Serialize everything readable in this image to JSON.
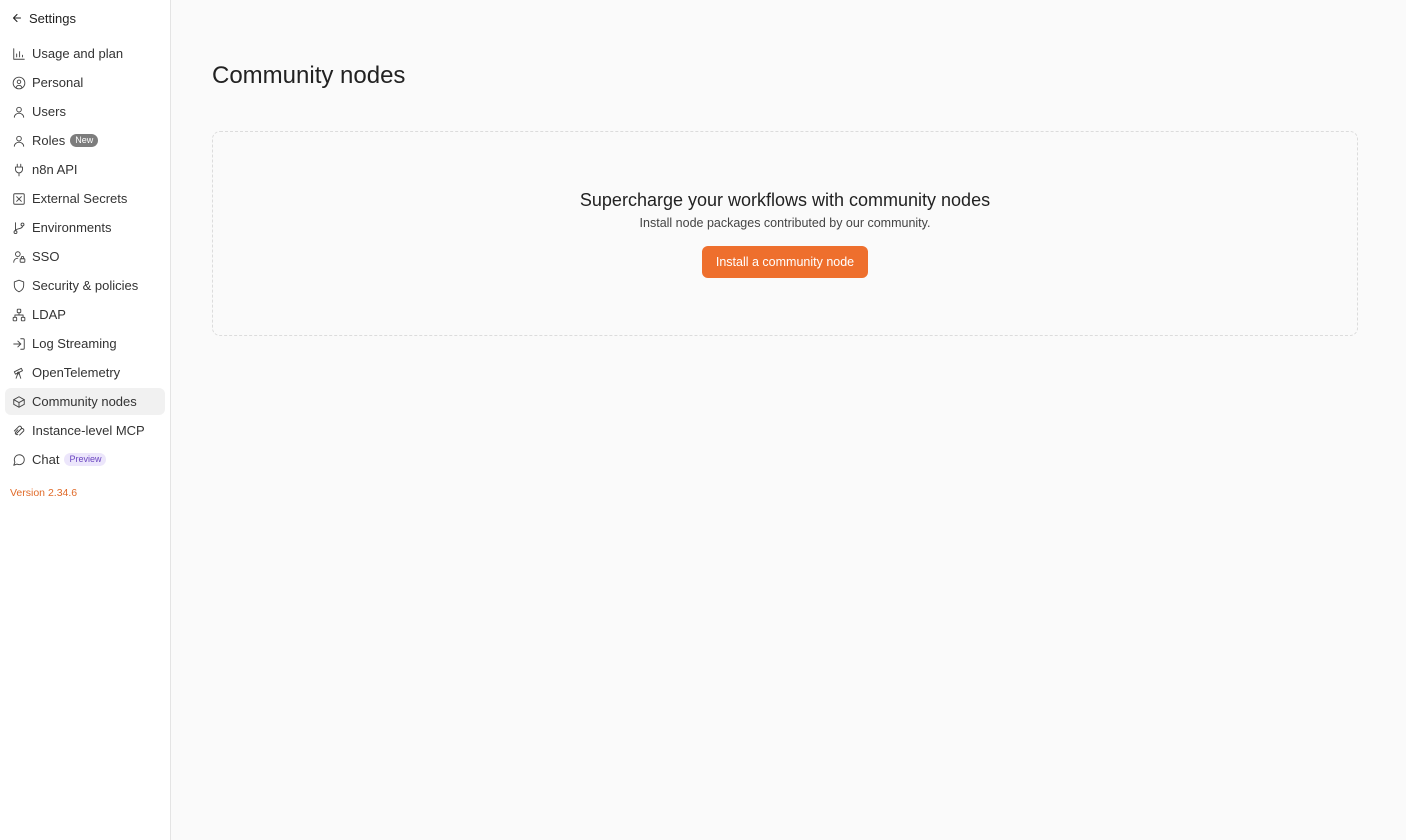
{
  "sidebar": {
    "back_label": "Settings",
    "items": [
      {
        "label": "Usage and plan",
        "icon": "bar-chart-icon"
      },
      {
        "label": "Personal",
        "icon": "user-circle-icon"
      },
      {
        "label": "Users",
        "icon": "user-icon"
      },
      {
        "label": "Roles",
        "icon": "user-icon",
        "badge": "New"
      },
      {
        "label": "n8n API",
        "icon": "plug-icon"
      },
      {
        "label": "External Secrets",
        "icon": "vault-icon"
      },
      {
        "label": "Environments",
        "icon": "git-branch-icon"
      },
      {
        "label": "SSO",
        "icon": "user-lock-icon"
      },
      {
        "label": "Security & policies",
        "icon": "shield-icon"
      },
      {
        "label": "LDAP",
        "icon": "network-icon"
      },
      {
        "label": "Log Streaming",
        "icon": "log-in-icon"
      },
      {
        "label": "OpenTelemetry",
        "icon": "telescope-icon"
      },
      {
        "label": "Community nodes",
        "icon": "box-icon",
        "active": true
      },
      {
        "label": "Instance-level MCP",
        "icon": "mcp-icon"
      },
      {
        "label": "Chat",
        "icon": "message-circle-icon",
        "badge": "Preview"
      }
    ],
    "version": "Version 2.34.6"
  },
  "main": {
    "title": "Community nodes",
    "empty_state": {
      "heading": "Supercharge your workflows with community nodes",
      "description": "Install node packages contributed by our community.",
      "button_label": "Install a community node"
    }
  },
  "colors": {
    "accent": "#ee6f2d",
    "version_text": "#e06b2a",
    "active_item_bg": "#f1f1f1"
  }
}
